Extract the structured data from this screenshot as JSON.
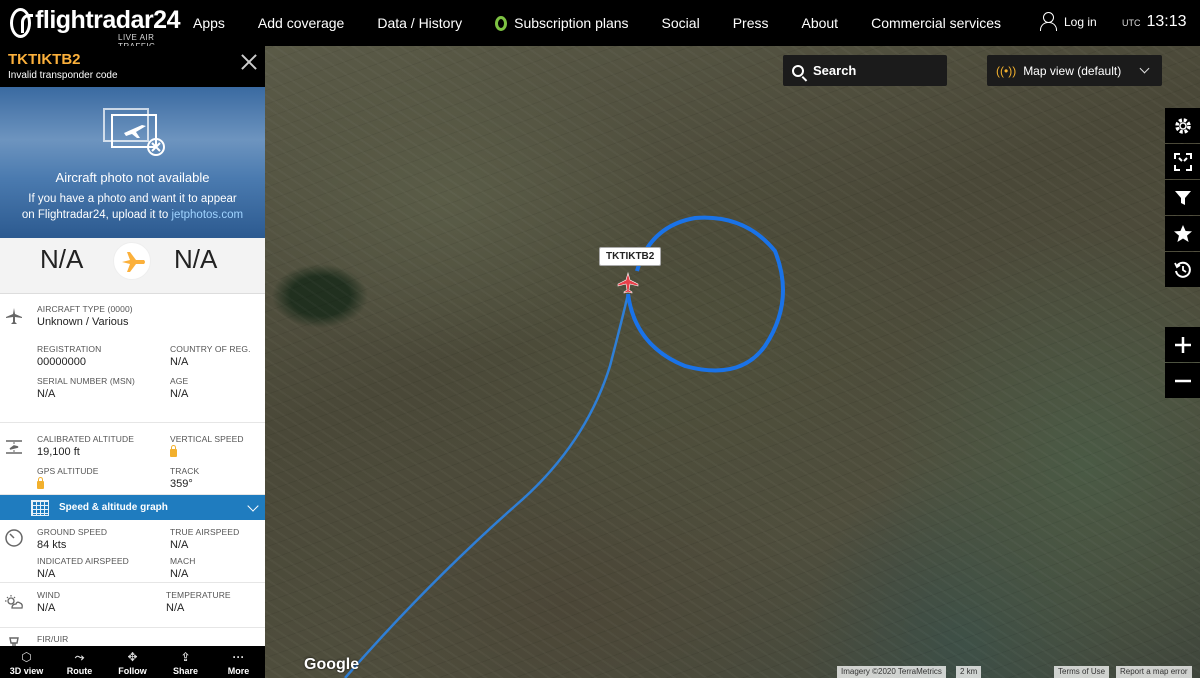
{
  "topbar": {
    "logo_text": "flightradar24",
    "logo_sub": "LIVE AIR TRAFFIC",
    "nav": [
      "Apps",
      "Add coverage",
      "Data / History",
      "Subscription plans",
      "Social",
      "Press",
      "About",
      "Commercial services"
    ],
    "login": "Log in",
    "utc_label": "UTC",
    "time": "13:13"
  },
  "panel": {
    "callsign": "TKTIKTB2",
    "squawk_note": "Invalid transponder code",
    "photo_title": "Aircraft photo not available",
    "photo_msg_1": "If you have a photo and want it to appear",
    "photo_msg_2": "on Flightradar24, upload it to ",
    "photo_link": "jetphotos.com",
    "origin": "N/A",
    "destination": "N/A",
    "aircraft_type_label": "AIRCRAFT TYPE",
    "aircraft_type_code": "(0000)",
    "aircraft_type_value": "Unknown / Various",
    "registration_label": "REGISTRATION",
    "registration_value": "00000000",
    "country_label": "COUNTRY OF REG.",
    "country_value": "N/A",
    "serial_label": "SERIAL NUMBER (MSN)",
    "serial_value": "N/A",
    "age_label": "AGE",
    "age_value": "N/A",
    "cal_alt_label": "CALIBRATED ALTITUDE",
    "cal_alt_value": "19,100 ft",
    "vspeed_label": "VERTICAL SPEED",
    "gps_alt_label": "GPS ALTITUDE",
    "track_label": "TRACK",
    "track_value": "359°",
    "graph_label": "Speed & altitude graph",
    "ground_speed_label": "GROUND SPEED",
    "ground_speed_value": "84 kts",
    "true_as_label": "TRUE AIRSPEED",
    "true_as_value": "N/A",
    "ind_as_label": "INDICATED AIRSPEED",
    "ind_as_value": "N/A",
    "mach_label": "MACH",
    "mach_value": "N/A",
    "wind_label": "WIND",
    "wind_value": "N/A",
    "temp_label": "TEMPERATURE",
    "temp_value": "N/A",
    "fir_label": "FIR/UIR"
  },
  "bottombar": [
    "3D view",
    "Route",
    "Follow",
    "Share",
    "More"
  ],
  "map": {
    "search_label": "Search",
    "mapview_label": "Map view (default)",
    "aircraft_tag": "TKTIKTB2",
    "google": "Google",
    "imagery": "Imagery ©2020 TerraMetrics",
    "scale": "2 km",
    "terms": "Terms of Use",
    "report": "Report a map error"
  },
  "colors": {
    "accent": "#fbb03b",
    "track": "#2f7fd6",
    "circle": "#1a73e8",
    "aircraft": "#e8404a",
    "graph_bar": "#1f7cbf"
  }
}
